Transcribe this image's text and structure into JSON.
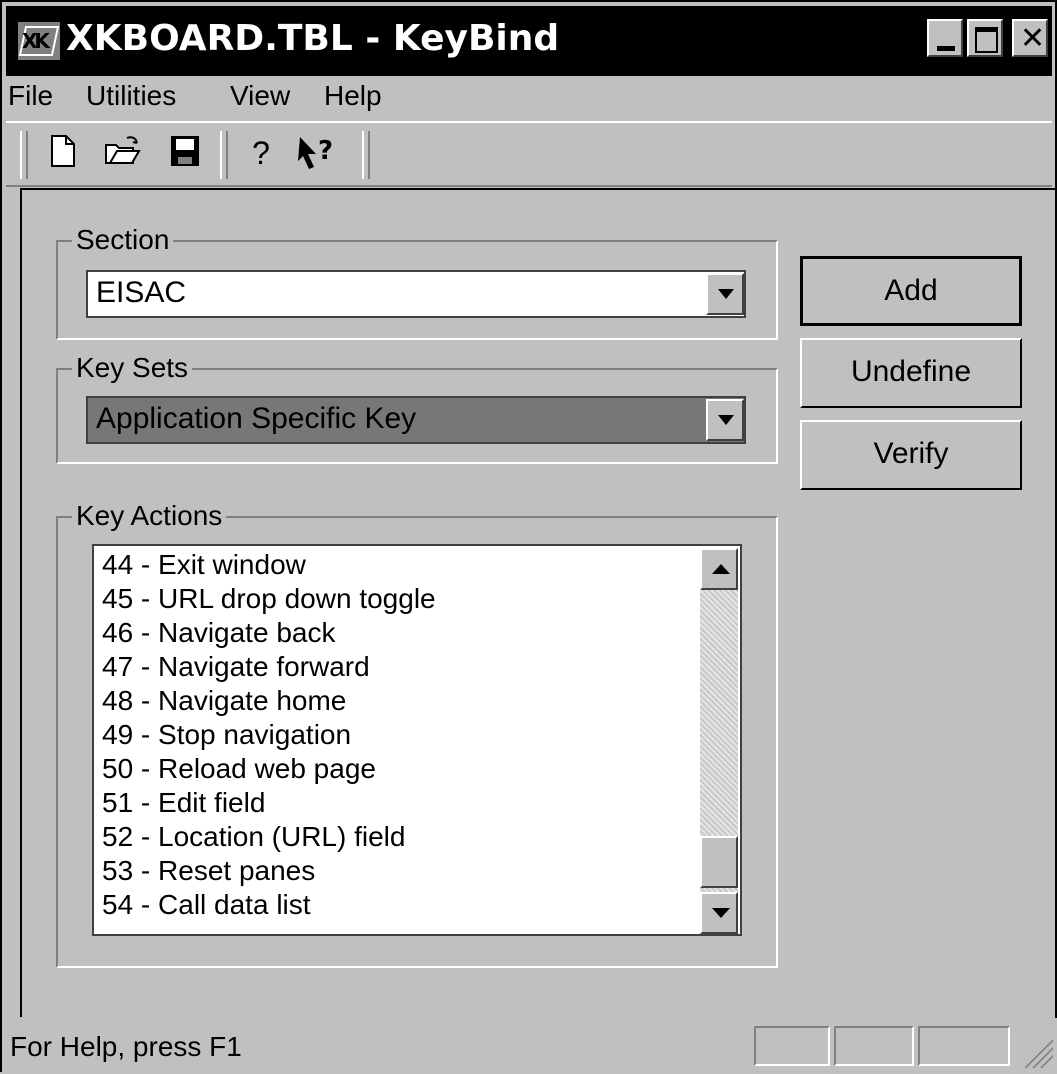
{
  "window": {
    "title": "XKBOARD.TBL - KeyBind",
    "icon": "app-keyboard-icon"
  },
  "menu": {
    "items": [
      "File",
      "Utilities",
      "View",
      "Help"
    ]
  },
  "toolbar": {
    "buttons": [
      "new-document-icon",
      "open-folder-icon",
      "save-disk-icon",
      "help-icon",
      "context-help-icon"
    ]
  },
  "section": {
    "label": "Section",
    "value": "EISAC"
  },
  "key_sets": {
    "label": "Key Sets",
    "value": "Application Specific Key"
  },
  "key_actions": {
    "label": "Key Actions",
    "items": [
      "44 - Exit window",
      "45 - URL drop down toggle",
      "46 - Navigate back",
      "47 - Navigate forward",
      "48 - Navigate home",
      "49 - Stop navigation",
      "50 - Reload web page",
      "51 - Edit field",
      "52 - Location (URL) field",
      "53 - Reset panes",
      "54 - Call data list"
    ]
  },
  "buttons": {
    "add": "Add",
    "undefine": "Undefine",
    "verify": "Verify"
  },
  "status": {
    "text": "For Help, press F1"
  },
  "colors": {
    "face": "#c0c0c0",
    "title_bg": "#000000",
    "selected_bg": "#777777"
  }
}
